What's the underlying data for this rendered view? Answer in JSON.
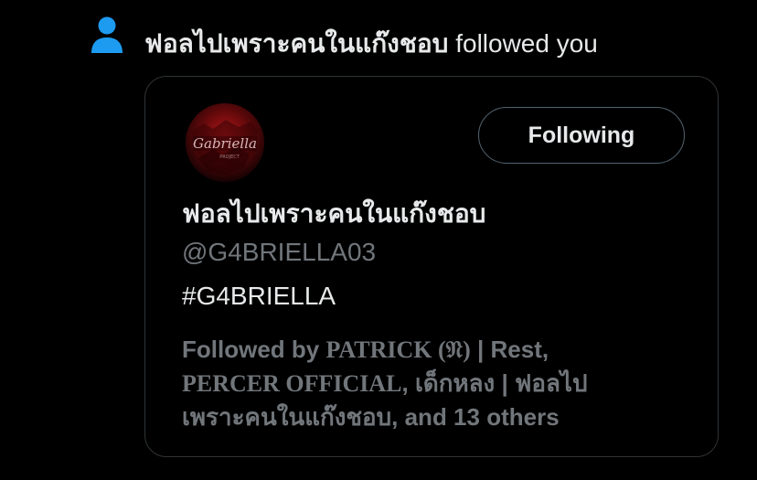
{
  "notification": {
    "icon": "person-icon",
    "icon_color": "#1d9bf0",
    "actor_name": "ฟอลไปเพราะคนในแก๊งชอบ",
    "action_text": " followed you"
  },
  "user_card": {
    "avatar": {
      "description_icon": "avatar",
      "logo_text": "Gabriella"
    },
    "follow_button_label": "Following",
    "display_name": "ฟอลไปเพราะคนในแก๊งชอบ",
    "handle": "@G4BRIELLA03",
    "bio": "#G4BRIELLA",
    "followed_by": {
      "prefix": "Followed by ",
      "name1": "PATRICK (𝔑)",
      "sep1": " | Rest,",
      "name2": "PERCER OFFICIAL",
      "sep2": ", เด็กหลง | ฟอลไป",
      "line3": "เพราะคนในแก๊งชอบ, and 13 others"
    }
  },
  "colors": {
    "background": "#000000",
    "text_primary": "#e7e9ea",
    "text_secondary": "#71767b",
    "border": "#2f3336",
    "accent": "#1d9bf0"
  }
}
